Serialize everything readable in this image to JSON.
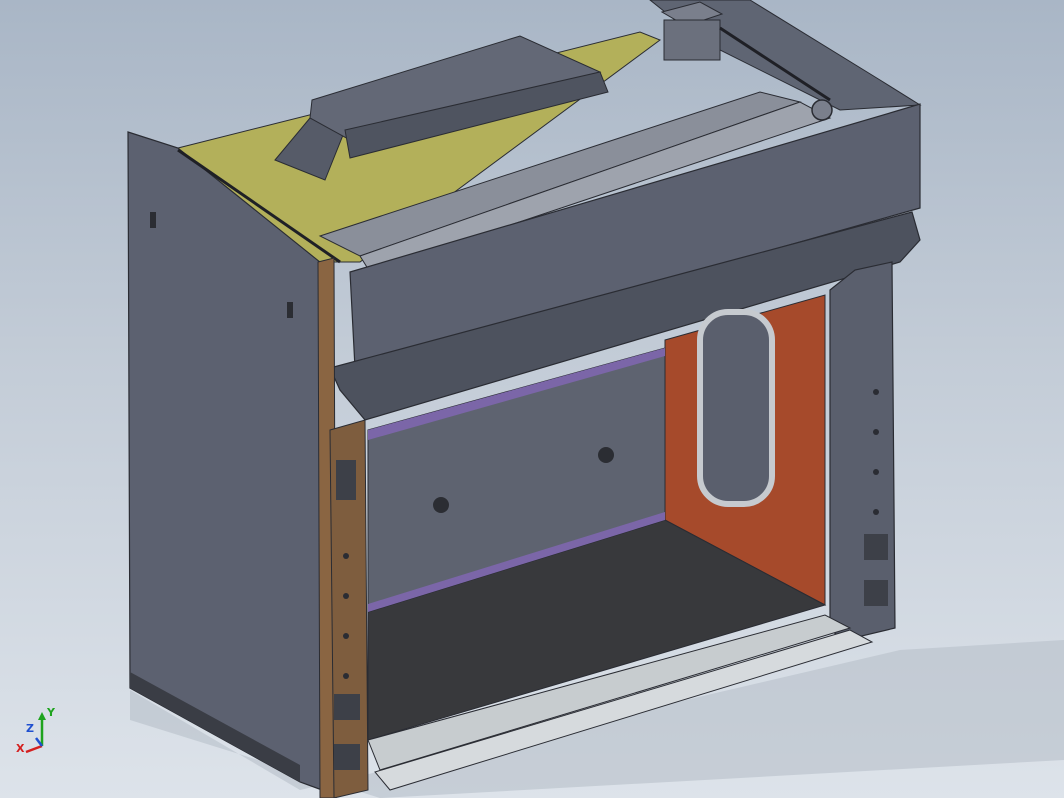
{
  "viewport": {
    "background_top": "#a9b6c6",
    "background_bottom": "#dde3ea"
  },
  "model": {
    "description_icon": "fume-hood-3d-model",
    "colors": {
      "body_gray": "#5f6573",
      "body_dark": "#4b505c",
      "top_yellow": "#b6b35a",
      "copper_frame": "#8a6542",
      "back_orange": "#a84a2a",
      "floor_dark": "#3a3b3e",
      "purple_strip": "#7b66a8",
      "sash_light": "#c7cccf"
    }
  },
  "triad": {
    "x_label": "X",
    "y_label": "Y",
    "z_label": "Z",
    "x_color": "#d42020",
    "y_color": "#1ea31e",
    "z_color": "#2050d0"
  }
}
